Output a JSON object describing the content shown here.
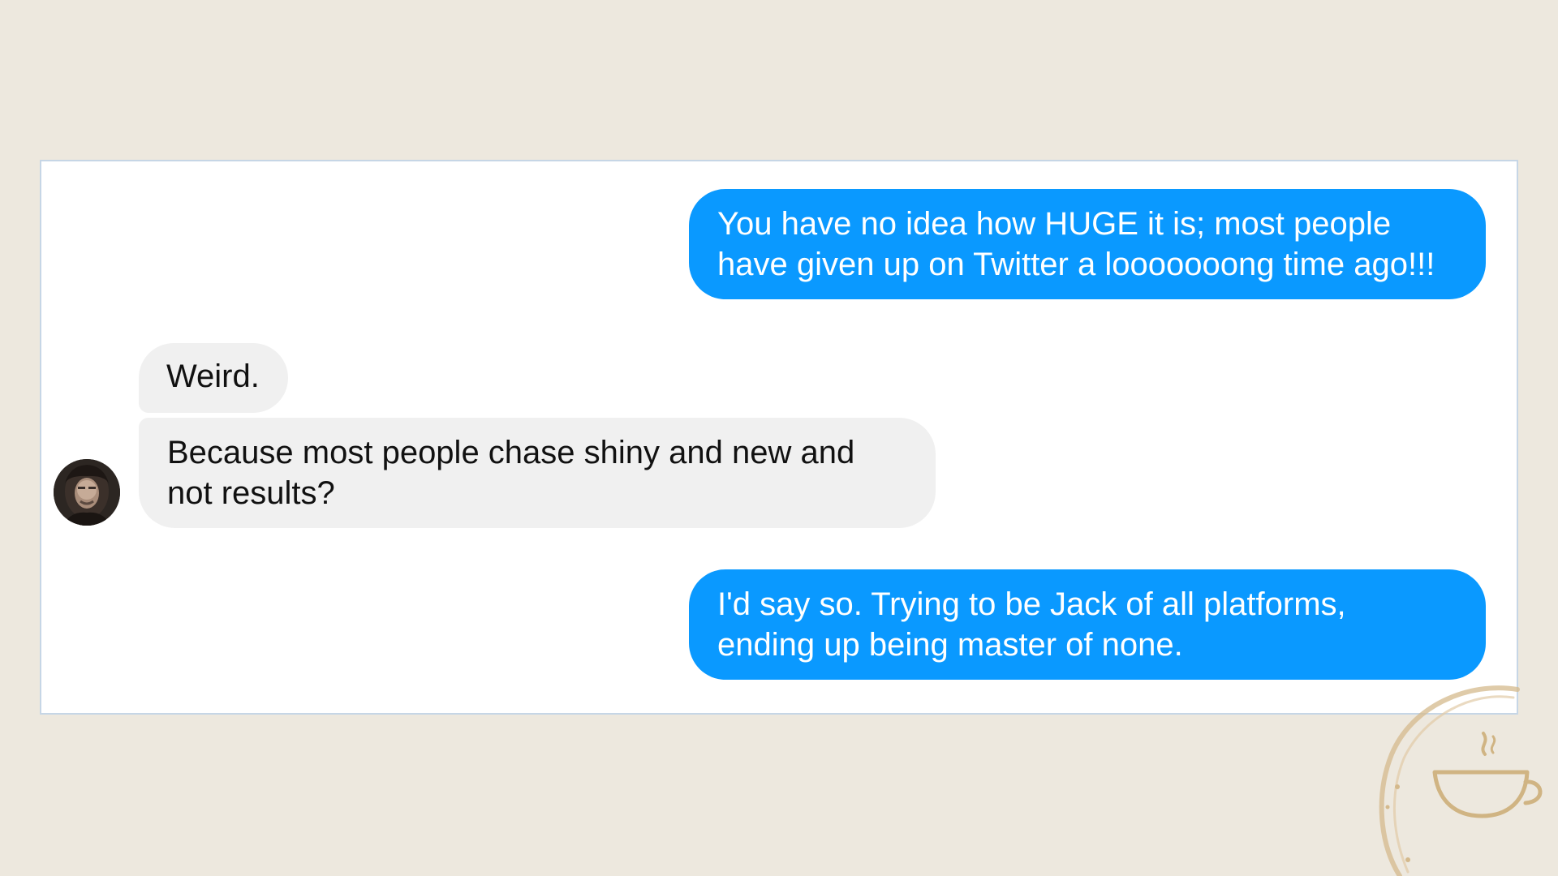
{
  "conversation": {
    "messages": [
      {
        "direction": "outgoing",
        "text": "You have no idea how HUGE it is; most people\nhave given up on Twitter a looooooong time ago!!!"
      },
      {
        "direction": "incoming",
        "text": "Weird."
      },
      {
        "direction": "incoming",
        "text": "Because most people chase shiny and new and\nnot results?"
      },
      {
        "direction": "outgoing",
        "text": "I'd say so. Trying to be Jack of all platforms,\nending up being master of none."
      }
    ],
    "avatar_icon": "contact-avatar-photo"
  },
  "decoration": {
    "stamp_icon": "coffee-cup-stain-icon"
  },
  "colors": {
    "background": "#ede8de",
    "panel": "#ffffff",
    "outgoing_bubble": "#0a99ff",
    "incoming_bubble": "#f0f0f0",
    "stain": "#d4b98c"
  }
}
